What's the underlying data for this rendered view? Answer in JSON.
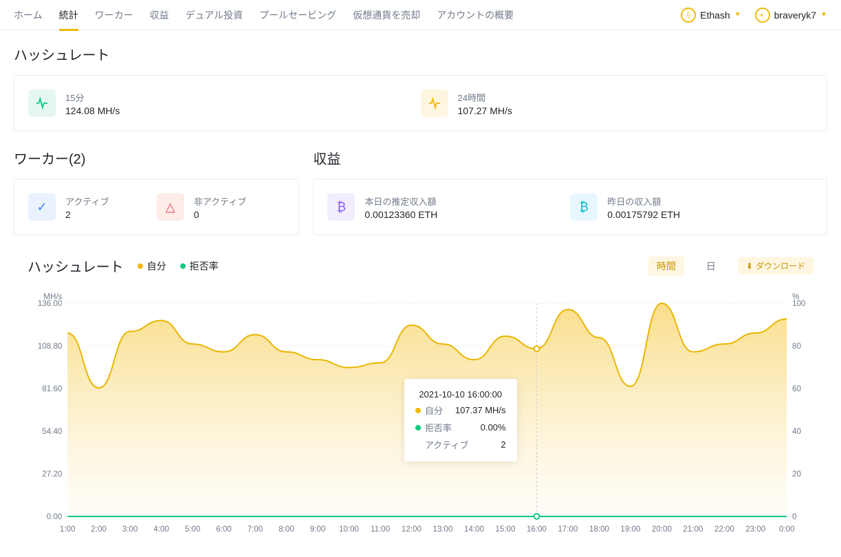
{
  "nav": {
    "items": [
      "ホーム",
      "統計",
      "ワーカー",
      "収益",
      "デュアル投資",
      "プールセービング",
      "仮想通貨を売却",
      "アカウントの概要"
    ],
    "activeIndex": 1,
    "algo": "Ethash",
    "user": "braveryk7"
  },
  "hashrate": {
    "title": "ハッシュレート",
    "m15_label": "15分",
    "m15_value": "124.08 MH/s",
    "h24_label": "24時間",
    "h24_value": "107.27 MH/s"
  },
  "workers": {
    "title": "ワーカー(2)",
    "active_label": "アクティブ",
    "active_count": "2",
    "inactive_label": "非アクティブ",
    "inactive_count": "0"
  },
  "earnings": {
    "title": "収益",
    "today_label": "本日の推定収入額",
    "today_value": "0.00123360 ETH",
    "yesterday_label": "昨日の収入額",
    "yesterday_value": "0.00175792 ETH"
  },
  "chart": {
    "title": "ハッシュレート",
    "legend_self": "自分",
    "legend_reject": "拒否率",
    "btn_hour": "時間",
    "btn_day": "日",
    "btn_download": "ダウンロード",
    "y_unit": "MH/s",
    "y2_unit": "%",
    "tooltip": {
      "time": "2021-10-10 16:00:00",
      "self_label": "自分",
      "self_value": "107.37 MH/s",
      "reject_label": "拒否率",
      "reject_value": "0.00%",
      "active_label": "アクティブ",
      "active_value": "2"
    }
  },
  "chart_data": {
    "type": "area",
    "title": "ハッシュレート",
    "xlabel": "",
    "ylabel": "MH/s",
    "y2label": "%",
    "ylim": [
      0,
      136
    ],
    "y2lim": [
      0,
      100
    ],
    "y_ticks": [
      0.0,
      27.2,
      54.4,
      81.6,
      108.8,
      136.0
    ],
    "y2_ticks": [
      0,
      20,
      40,
      60,
      80,
      100
    ],
    "categories": [
      "1:00",
      "2:00",
      "3:00",
      "4:00",
      "5:00",
      "6:00",
      "7:00",
      "8:00",
      "9:00",
      "10:00",
      "11:00",
      "12:00",
      "13:00",
      "14:00",
      "15:00",
      "16:00",
      "17:00",
      "18:00",
      "19:00",
      "20:00",
      "21:00",
      "22:00",
      "23:00",
      "0:00"
    ],
    "series": [
      {
        "name": "自分",
        "axis": "y",
        "values": [
          117,
          82,
          118,
          125,
          110,
          105,
          116,
          105,
          100,
          95,
          98,
          122,
          110,
          100,
          115,
          107,
          132,
          114,
          83,
          136,
          105,
          110,
          117,
          126
        ]
      },
      {
        "name": "拒否率",
        "axis": "y2",
        "values": [
          0,
          0,
          0,
          0,
          0,
          0,
          0,
          0,
          0,
          0,
          0,
          0,
          0,
          0,
          0,
          0,
          0,
          0,
          0,
          0,
          0,
          0,
          0,
          0
        ]
      }
    ]
  }
}
